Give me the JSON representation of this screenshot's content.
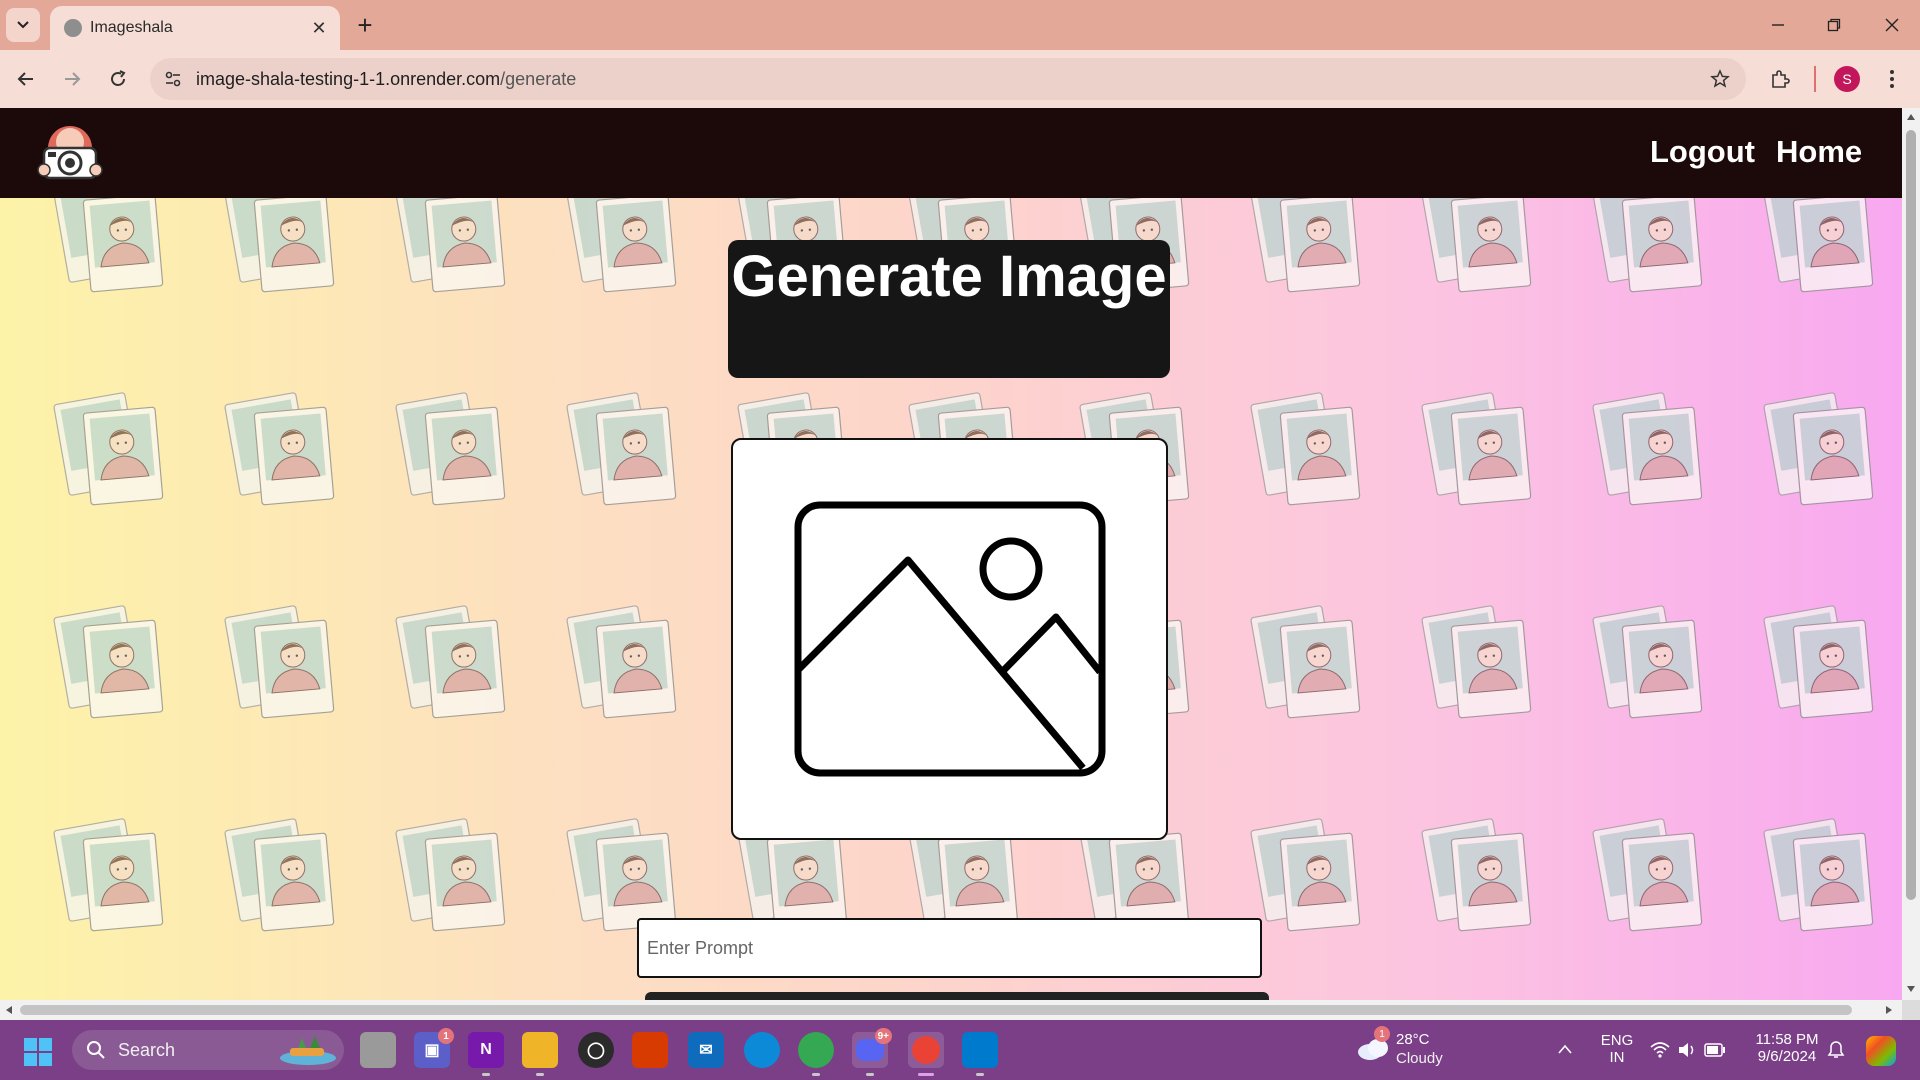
{
  "browser": {
    "tab_title": "Imageshala",
    "url_host": "image-shala-testing-1-1.onrender.com",
    "url_path": "/generate",
    "profile_initial": "S"
  },
  "site": {
    "nav": {
      "logout": "Logout",
      "home": "Home"
    },
    "page_title": "Generate Image",
    "prompt_placeholder": "Enter Prompt",
    "prompt_value": ""
  },
  "taskbar": {
    "search_label": "Search",
    "apps": [
      {
        "name": "file-explorer-task-view",
        "badge": ""
      },
      {
        "name": "teams",
        "badge": "1"
      },
      {
        "name": "onenote",
        "badge": ""
      },
      {
        "name": "files",
        "badge": ""
      },
      {
        "name": "app-circle",
        "badge": ""
      },
      {
        "name": "office",
        "badge": ""
      },
      {
        "name": "mail",
        "badge": ""
      },
      {
        "name": "edge",
        "badge": ""
      },
      {
        "name": "chrome",
        "badge": ""
      },
      {
        "name": "discord",
        "badge": "9+"
      },
      {
        "name": "chrome-profile",
        "badge": ""
      },
      {
        "name": "vscode",
        "badge": ""
      }
    ],
    "weather": {
      "badge": "1",
      "temp": "28°C",
      "condition": "Cloudy"
    },
    "language": {
      "line1": "ENG",
      "line2": "IN"
    },
    "clock": {
      "time": "11:58 PM",
      "date": "9/6/2024"
    }
  },
  "colors": {
    "header_bg": "#1c0a0a",
    "title_bg": "#161616",
    "gradient_left": "#fdf3a8",
    "gradient_right": "#f8a8f0",
    "taskbar_bg": "#7a3f86"
  }
}
